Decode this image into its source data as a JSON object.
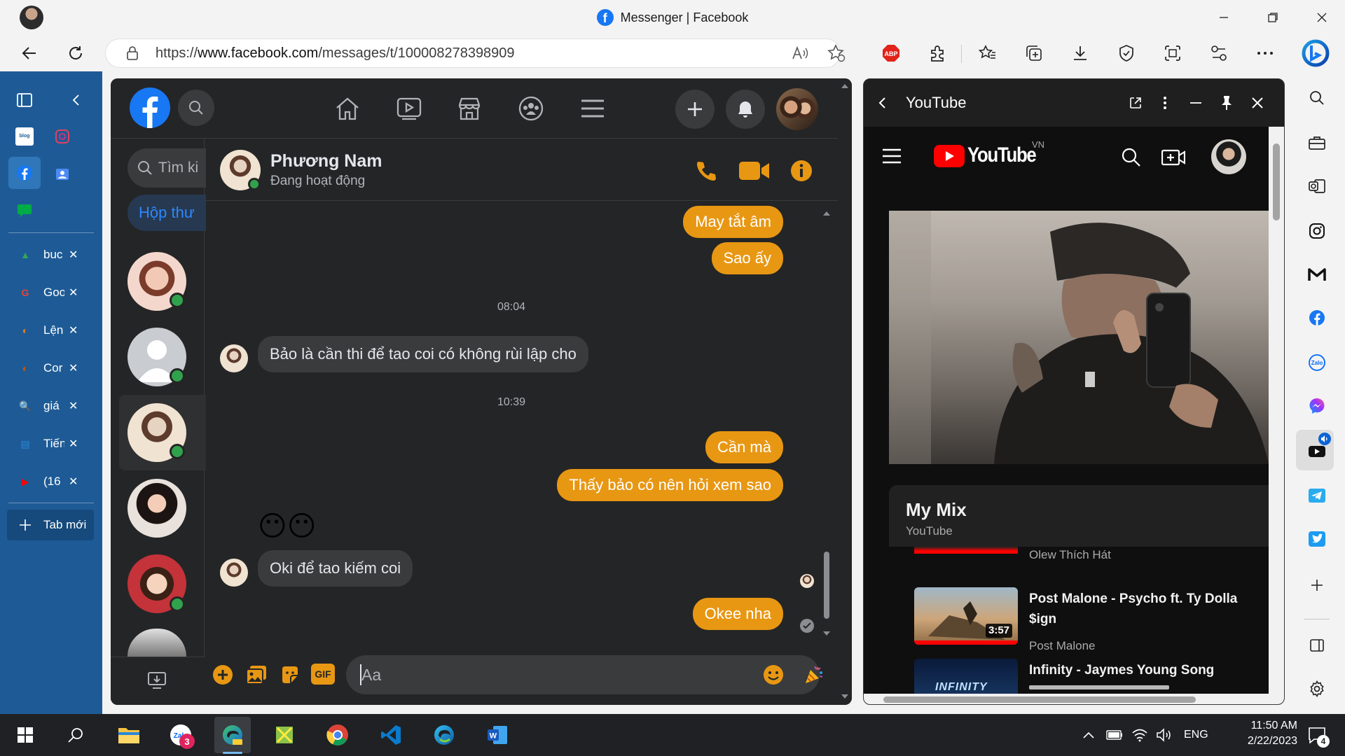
{
  "window": {
    "title": "Messenger | Facebook",
    "fb_glyph": "f"
  },
  "address": {
    "url_prefix": "https://",
    "url_domain": "www.facebook.com",
    "url_path": "/messages/t/100008278398909"
  },
  "vertical_tabs": [
    {
      "label": "buc",
      "icon": "drive-icon",
      "color": "#34a853"
    },
    {
      "label": "Goo",
      "icon": "google-icon",
      "color": "#ea4335"
    },
    {
      "label": "Lện",
      "icon": "colorful-icon",
      "color": "#e67e22"
    },
    {
      "label": "Cor",
      "icon": "colorful-icon",
      "color": "#d35400"
    },
    {
      "label": "giá",
      "icon": "search-icon",
      "color": "#3b82f6"
    },
    {
      "label": "Tiến",
      "icon": "document-icon",
      "color": "#2b88d8"
    },
    {
      "label": "(16",
      "icon": "youtube-icon",
      "color": "#ff0000"
    }
  ],
  "new_tab_label": "Tab mới",
  "messenger": {
    "search_placeholder": "Tìm ki",
    "inbox_label": "Hộp thư",
    "contact_name": "Phương Nam",
    "contact_status": "Đang hoạt động",
    "composer_placeholder": "Aa",
    "gif_label": "GIF",
    "emoji_row": "😶😶",
    "messages": [
      {
        "type": "out",
        "text": "May tắt âm"
      },
      {
        "type": "out",
        "text": "Sao ấy"
      },
      {
        "type": "time",
        "text": "08:04"
      },
      {
        "type": "in",
        "text": "Bảo là cần thi để tao coi có không rùi lập cho"
      },
      {
        "type": "time",
        "text": "10:39"
      },
      {
        "type": "out",
        "text": "Cần mà"
      },
      {
        "type": "out",
        "text": "Thấy bảo có nên hỏi xem sao"
      },
      {
        "type": "in",
        "text": "Oki để tao kiếm coi"
      },
      {
        "type": "out",
        "text": "Okee nha"
      }
    ],
    "accent": "#e89713"
  },
  "youtube": {
    "panel_title": "YouTube",
    "logo_text": "YouTube",
    "region": "VN",
    "mix_title": "My Mix",
    "mix_subtitle": "YouTube",
    "items": [
      {
        "title": "",
        "channel": "Olew Thích Hát",
        "duration": ""
      },
      {
        "title": "Post Malone - Psycho ft. Ty Dolla $ign",
        "channel": "Post Malone",
        "duration": "3:57"
      },
      {
        "title": "Infinity - Jaymes Young Song",
        "channel": "",
        "duration": ""
      }
    ],
    "thumb_infinity": "INFINITY"
  },
  "taskbar": {
    "time": "11:50 AM",
    "date": "2/22/2023",
    "lang": "ENG",
    "zalo_badge": "3",
    "notif_badge": "4"
  }
}
